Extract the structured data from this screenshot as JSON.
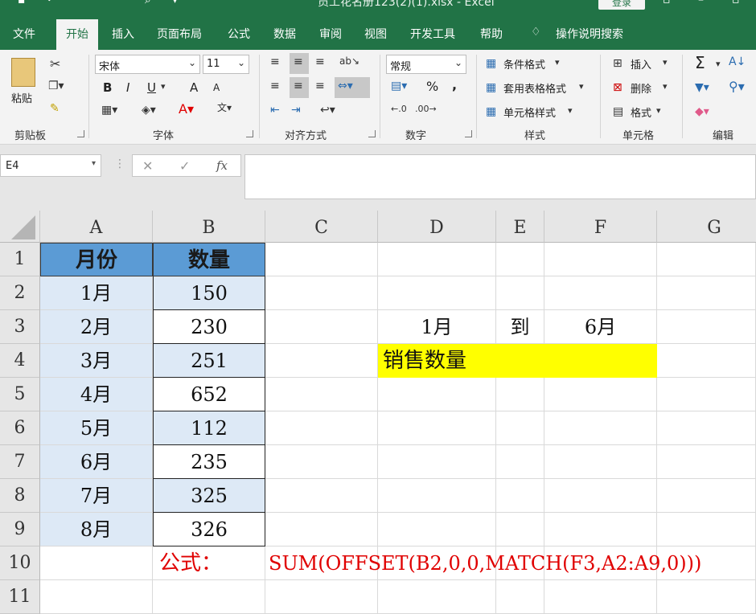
{
  "window": {
    "title": "员工花名册123(2)(1).xlsx  -  Excel",
    "login_label": "登录"
  },
  "tabs": [
    "文件",
    "开始",
    "插入",
    "页面布局",
    "公式",
    "数据",
    "审阅",
    "视图",
    "开发工具",
    "帮助",
    "操作说明搜索"
  ],
  "active_tab": "开始",
  "ribbon": {
    "clipboard": {
      "paste_label": "粘贴",
      "group_label": "剪贴板"
    },
    "font": {
      "font_name": "宋体",
      "font_size": "11",
      "bold": "B",
      "italic": "I",
      "underline": "U",
      "grow": "A",
      "shrink": "A",
      "group_label": "字体"
    },
    "alignment": {
      "group_label": "对齐方式"
    },
    "number": {
      "format": "常规",
      "percent": "%",
      "comma": ",",
      "group_label": "数字"
    },
    "styles": {
      "conditional": "条件格式",
      "table": "套用表格格式",
      "cell_styles": "单元格样式",
      "group_label": "样式"
    },
    "cells": {
      "insert": "插入",
      "delete": "删除",
      "format": "格式",
      "group_label": "单元格"
    },
    "editing": {
      "sum": "Σ",
      "group_label": "编辑"
    }
  },
  "formula_bar": {
    "name_box": "E4",
    "fx": "fx",
    "formula": ""
  },
  "columns": [
    "A",
    "B",
    "C",
    "D",
    "E",
    "F",
    "G"
  ],
  "rows": [
    "1",
    "2",
    "3",
    "4",
    "5",
    "6",
    "7",
    "8",
    "9",
    "10",
    "11"
  ],
  "table": {
    "header": [
      "月份",
      "数量"
    ],
    "months": [
      "1月",
      "2月",
      "3月",
      "4月",
      "5月",
      "6月",
      "7月",
      "8月"
    ],
    "quantities": [
      "150",
      "230",
      "251",
      "652",
      "112",
      "235",
      "325",
      "326"
    ]
  },
  "cells": {
    "D3": "1月",
    "E3": "到",
    "F3": "6月",
    "D4": "销售数量",
    "B10": "公式：",
    "C10": "SUM(OFFSET(B2,0,0,MATCH(F3,A2:A9,0)))"
  },
  "colors": {
    "excel_green": "#217346",
    "header_blue": "#5b9bd5",
    "light_blue": "#dde9f6",
    "highlight_yellow": "#ffff00",
    "formula_red": "#e00000"
  }
}
